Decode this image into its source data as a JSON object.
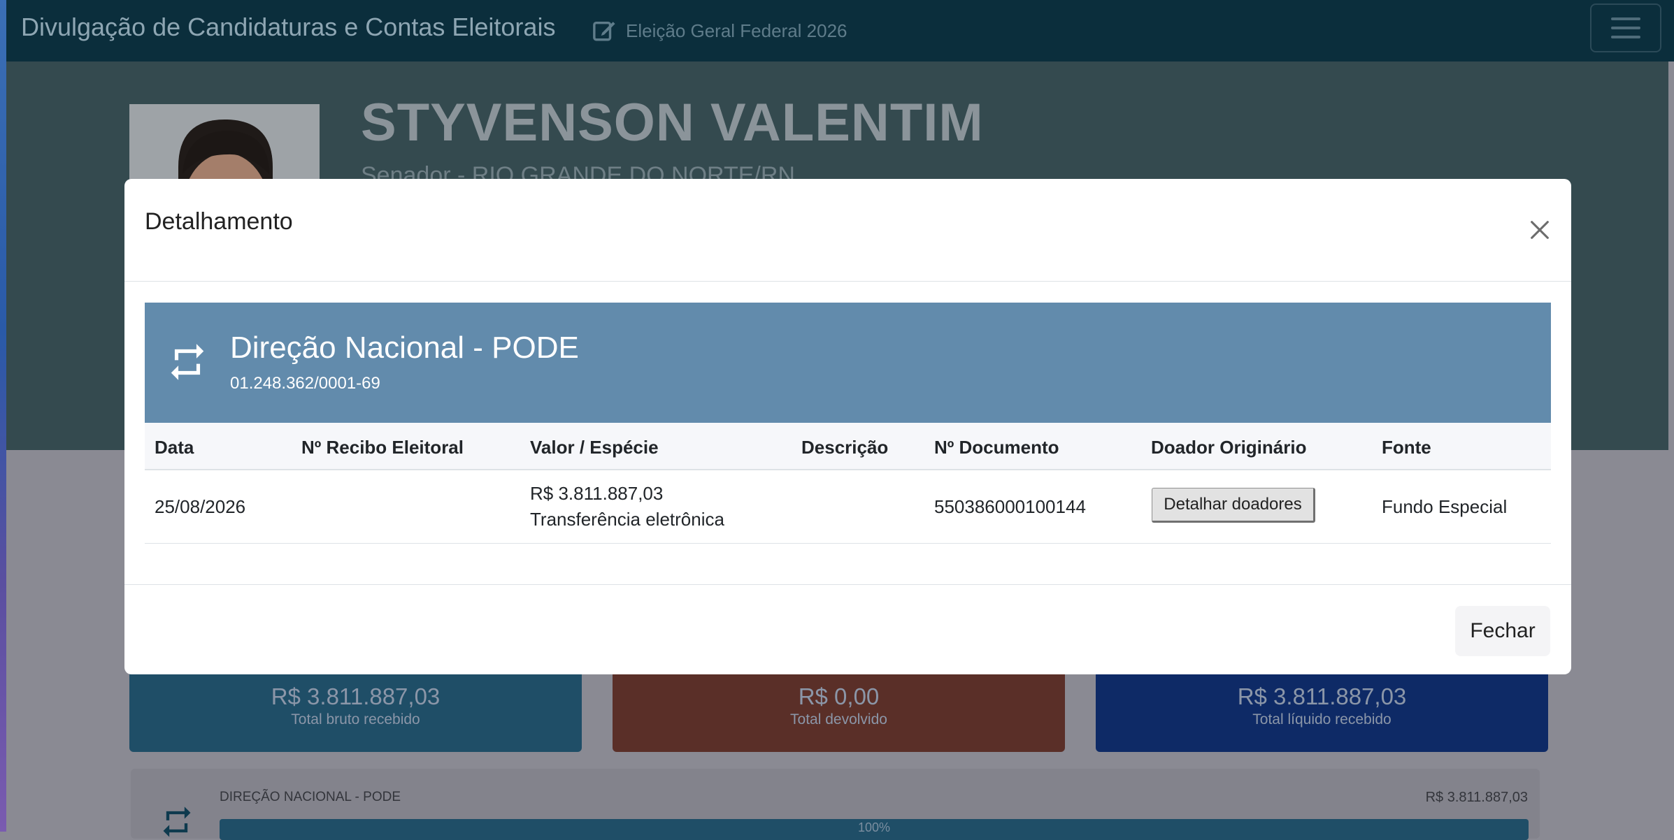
{
  "navbar": {
    "title": "Divulgação de Candidaturas e Contas Eleitorais",
    "election": "Eleição Geral Federal 2026"
  },
  "candidate": {
    "name": "STYVENSON VALENTIM",
    "subtitle": "Senador - RIO GRANDE DO NORTE/RN"
  },
  "summary_cards": [
    {
      "amount": "R$ 3.811.887,03",
      "label": "Total bruto recebido",
      "color": "#1f4e67"
    },
    {
      "amount": "R$ 0,00",
      "label": "Total devolvido",
      "color": "#5a2f28"
    },
    {
      "amount": "R$ 3.811.887,03",
      "label": "Total líquido recebido",
      "color": "#0e2a66"
    }
  ],
  "donor_summary": {
    "name": "DIREÇÃO NACIONAL - PODE",
    "value": "R$ 3.811.887,03",
    "percent": "100%"
  },
  "modal": {
    "title": "Detalhamento",
    "close_icon": "close-icon",
    "donor": {
      "icon": "transfer-icon",
      "name": "Direção Nacional - PODE",
      "cnpj": "01.248.362/0001-69",
      "color": "#628bac"
    },
    "columns": [
      "Data",
      "Nº Recibo Eleitoral",
      "Valor / Espécie",
      "Descrição",
      "Nº Documento",
      "Doador Originário",
      "Fonte"
    ],
    "rows": [
      {
        "data": "25/08/2026",
        "recibo": "",
        "valor": "R$ 3.811.887,03",
        "especie": "Transferência eletrônica",
        "descricao": "",
        "documento": "550386000100144",
        "doador_button": "Detalhar doadores",
        "fonte": "Fundo Especial"
      }
    ],
    "close_button": "Fechar"
  }
}
